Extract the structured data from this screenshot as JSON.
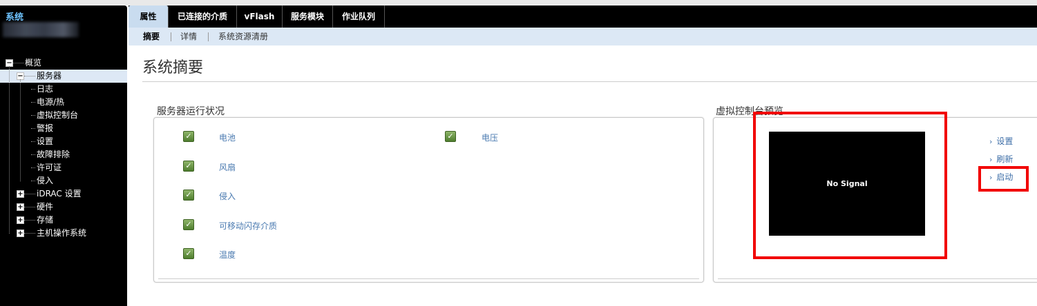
{
  "sidebar": {
    "title": "系统",
    "tree": [
      {
        "label": "概览",
        "level": 0,
        "expander": "−"
      },
      {
        "label": "服务器",
        "level": 1,
        "expander": "−",
        "selected": true
      },
      {
        "label": "日志",
        "level": 2
      },
      {
        "label": "电源/热",
        "level": 2
      },
      {
        "label": "虚拟控制台",
        "level": 2
      },
      {
        "label": "警报",
        "level": 2
      },
      {
        "label": "设置",
        "level": 2
      },
      {
        "label": "故障排除",
        "level": 2
      },
      {
        "label": "许可证",
        "level": 2
      },
      {
        "label": "侵入",
        "level": 2
      },
      {
        "label": "iDRAC 设置",
        "level": 1,
        "expander": "+"
      },
      {
        "label": "硬件",
        "level": 1,
        "expander": "+"
      },
      {
        "label": "存储",
        "level": 1,
        "expander": "+"
      },
      {
        "label": "主机操作系统",
        "level": 1,
        "expander": "+"
      }
    ]
  },
  "tabs": [
    {
      "label": "属性",
      "active": true
    },
    {
      "label": "已连接的介质"
    },
    {
      "label": "vFlash"
    },
    {
      "label": "服务模块"
    },
    {
      "label": "作业队列"
    }
  ],
  "subtabs": [
    {
      "label": "摘要",
      "active": true
    },
    {
      "label": "详情"
    },
    {
      "label": "系统资源清册"
    }
  ],
  "page_title": "系统摘要",
  "health": {
    "title": "服务器运行状况",
    "items_left": [
      "电池",
      "风扇",
      "侵入",
      "可移动闪存介质",
      "温度"
    ],
    "items_right": [
      "电压"
    ],
    "status_icon": "green-check-icon"
  },
  "console": {
    "title": "虚拟控制台预览",
    "screen_text": "No Signal",
    "links": [
      "设置",
      "刷新",
      "启动"
    ],
    "highlight_color": "#f10000"
  }
}
